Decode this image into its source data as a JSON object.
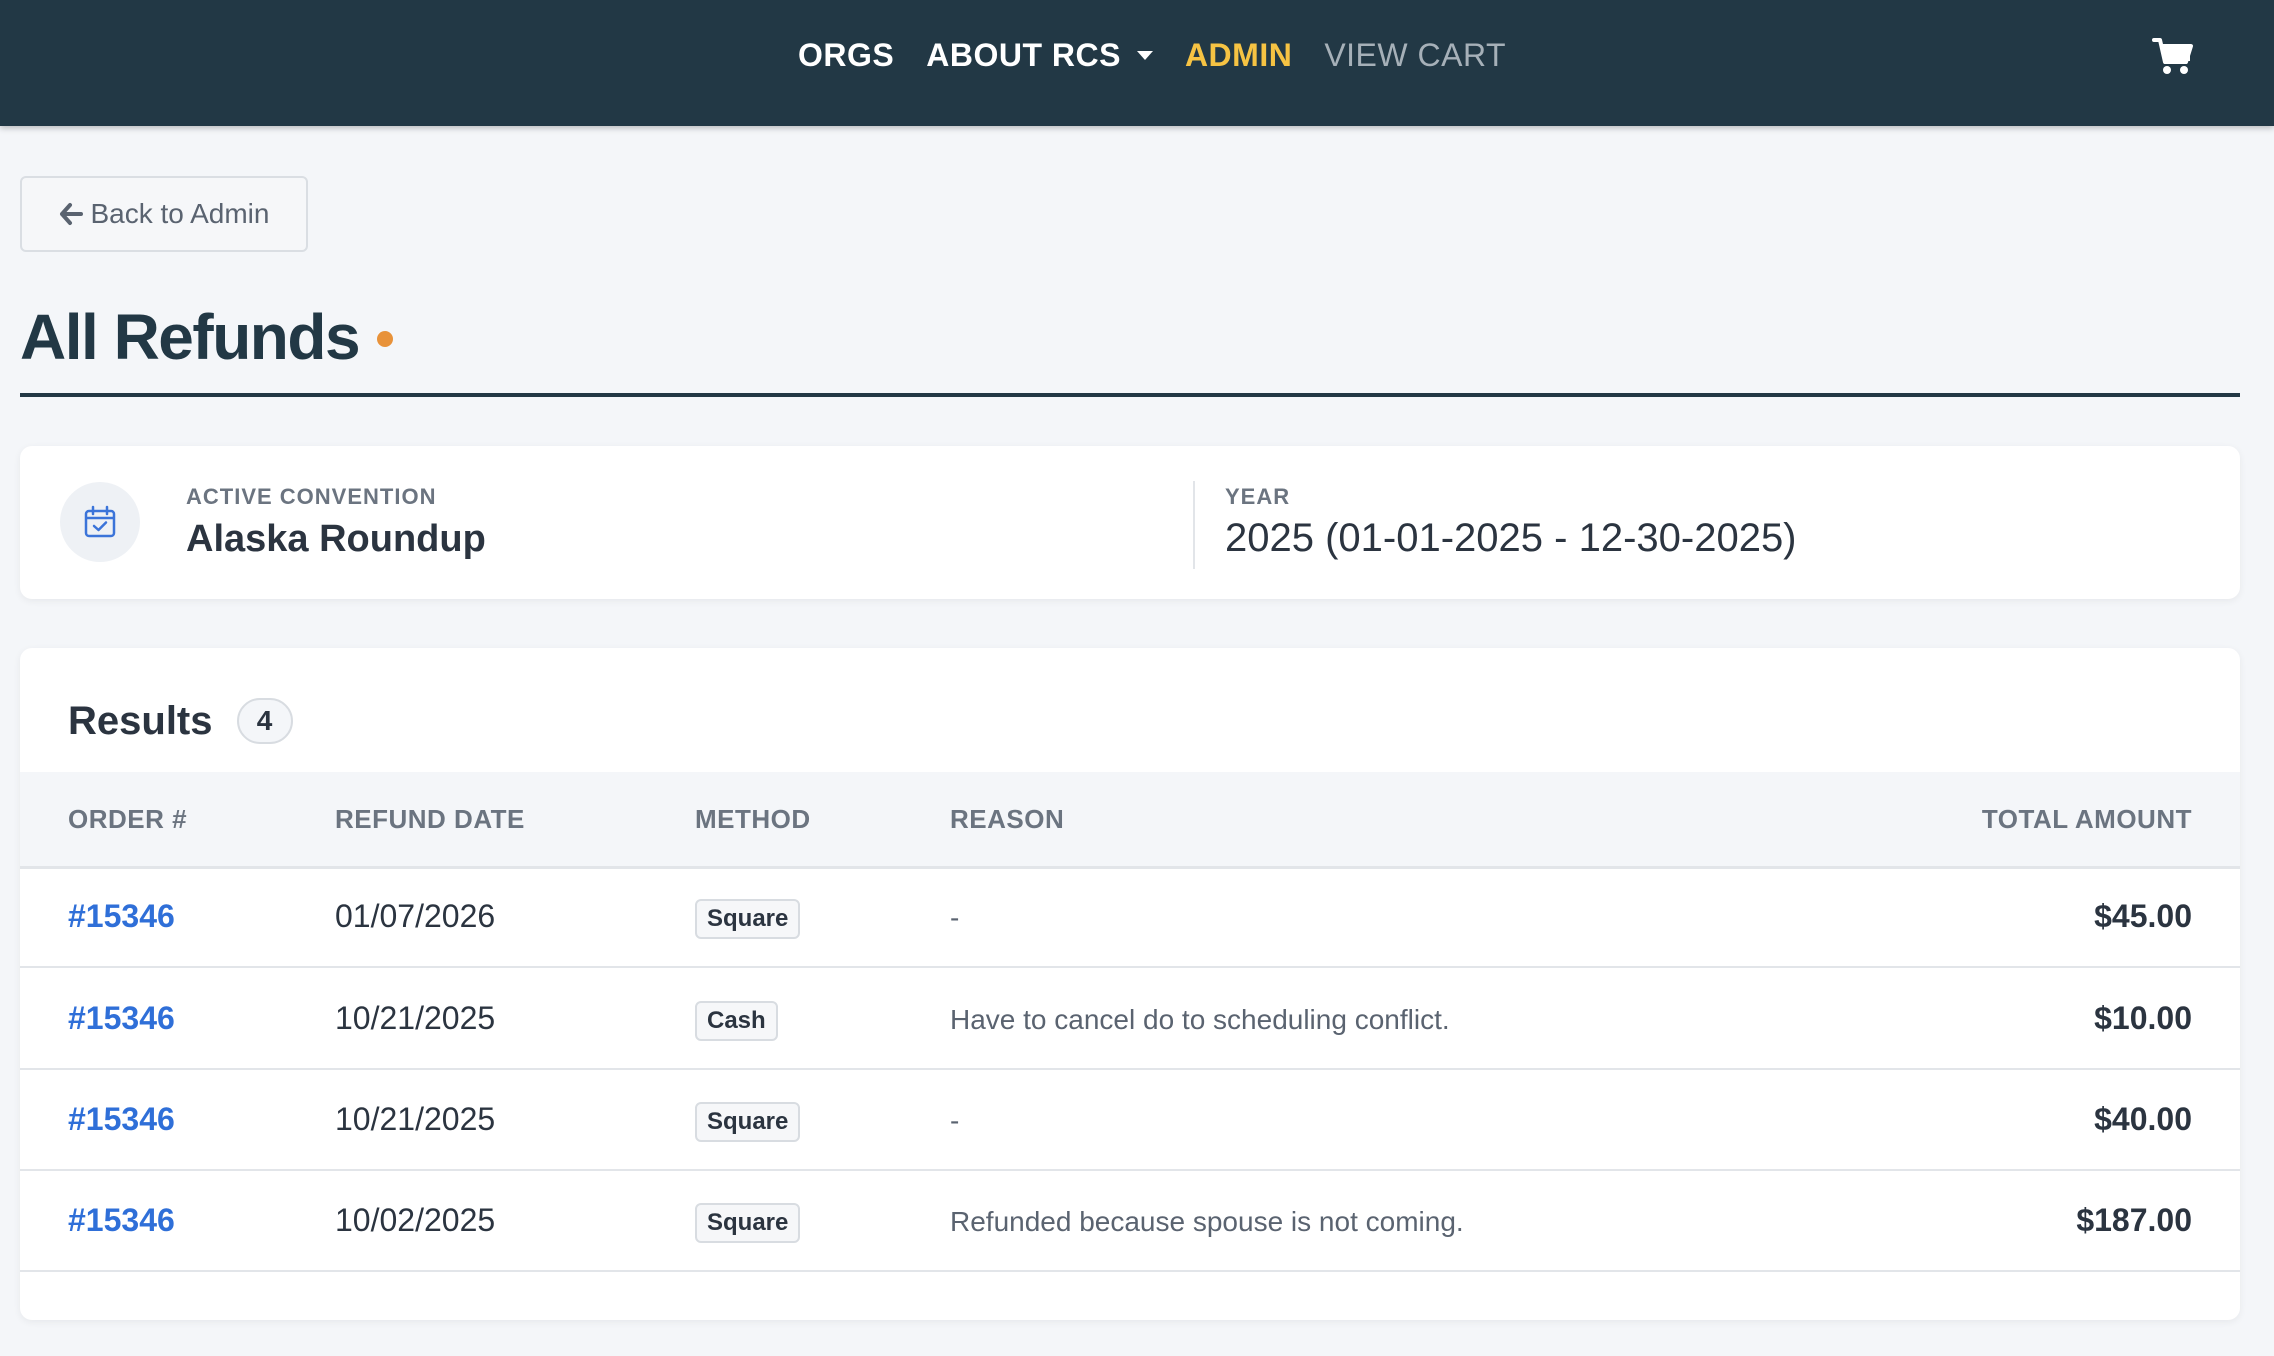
{
  "nav": {
    "links": [
      "ORGS",
      "ABOUT RCS",
      "ADMIN",
      "VIEW CART"
    ]
  },
  "back_button": {
    "label": "Back to Admin"
  },
  "page": {
    "title": "All Refunds"
  },
  "convention": {
    "label": "ACTIVE CONVENTION",
    "name": "Alaska Roundup",
    "year_label": "YEAR",
    "year_value": "2025 (01-01-2025 - 12-30-2025)"
  },
  "results": {
    "title": "Results",
    "count": "4",
    "columns": [
      "ORDER #",
      "REFUND DATE",
      "METHOD",
      "REASON",
      "TOTAL AMOUNT"
    ],
    "rows": [
      {
        "order": "#15346",
        "date": "01/07/2026",
        "method": "Square",
        "reason": "-",
        "total": "$45.00"
      },
      {
        "order": "#15346",
        "date": "10/21/2025",
        "method": "Cash",
        "reason": "Have to cancel do to scheduling conflict.",
        "total": "$10.00"
      },
      {
        "order": "#15346",
        "date": "10/21/2025",
        "method": "Square",
        "reason": "-",
        "total": "$40.00"
      },
      {
        "order": "#15346",
        "date": "10/02/2025",
        "method": "Square",
        "reason": "Refunded because spouse is not coming.",
        "total": "$187.00"
      }
    ]
  },
  "colors": {
    "nav_bg": "#223845",
    "nav_active": "#f6c343",
    "link": "#2f6fd8",
    "accent_dot": "#e8923a"
  },
  "icons": [
    "cart-icon",
    "arrow-left-icon",
    "calendar-check-icon",
    "caret-down-icon"
  ]
}
